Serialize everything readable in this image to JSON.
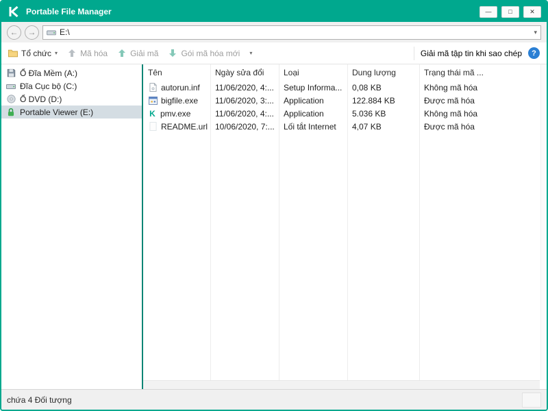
{
  "window": {
    "title": "Portable File Manager"
  },
  "colors": {
    "brand": "#00a88e",
    "pane_divider": "#0e8575",
    "selection": "#d4dde3",
    "help_blue": "#2a7fd4",
    "disabled_text": "#9d9d9d"
  },
  "icons": {
    "minimize": "—",
    "maximize": "□",
    "close": "✕",
    "back": "←",
    "forward": "→",
    "caret_down": "▾",
    "help": "?",
    "kaspersky_k": "K"
  },
  "address_bar": {
    "path": "E:\\"
  },
  "toolbar": {
    "organize": {
      "label": "Tổ chức"
    },
    "encrypt": {
      "label": "Mã hóa"
    },
    "decrypt": {
      "label": "Giải mã"
    },
    "new_package": {
      "label": "Gói mã hóa mới"
    },
    "decrypt_on_copy_label": "Giải mã tập tin khi sao chép"
  },
  "sidebar": {
    "items": [
      {
        "label": "Ổ Đĩa Mềm (A:)",
        "icon": "floppy-drive-icon",
        "selected": false
      },
      {
        "label": "Đĩa Cục bộ (C:)",
        "icon": "local-disk-icon",
        "selected": false
      },
      {
        "label": "Ổ DVD (D:)",
        "icon": "dvd-drive-icon",
        "selected": false
      },
      {
        "label": "Portable Viewer (E:)",
        "icon": "lock-icon",
        "selected": true
      }
    ]
  },
  "files": {
    "columns": [
      "Tên",
      "Ngày sửa đổi",
      "Loại",
      "Dung lượng",
      "Trạng thái mã ..."
    ],
    "rows": [
      {
        "name": "autorun.inf",
        "modified": "11/06/2020, 4:...",
        "type": "Setup Informa...",
        "size": "0,08 KB",
        "status": "Không mã hóa"
      },
      {
        "name": "bigfile.exe",
        "modified": "11/06/2020, 3:...",
        "type": "Application",
        "size": "122.884 KB",
        "status": "Được mã hóa"
      },
      {
        "name": "pmv.exe",
        "modified": "11/06/2020, 4:...",
        "type": "Application",
        "size": "5.036 KB",
        "status": "Không mã hóa"
      },
      {
        "name": "README.url",
        "modified": "10/06/2020, 7:...",
        "type": "Lối tắt Internet",
        "size": "4,07 KB",
        "status": "Được mã hóa"
      }
    ]
  },
  "status_bar": {
    "text": "chứa 4 Đối tượng"
  }
}
